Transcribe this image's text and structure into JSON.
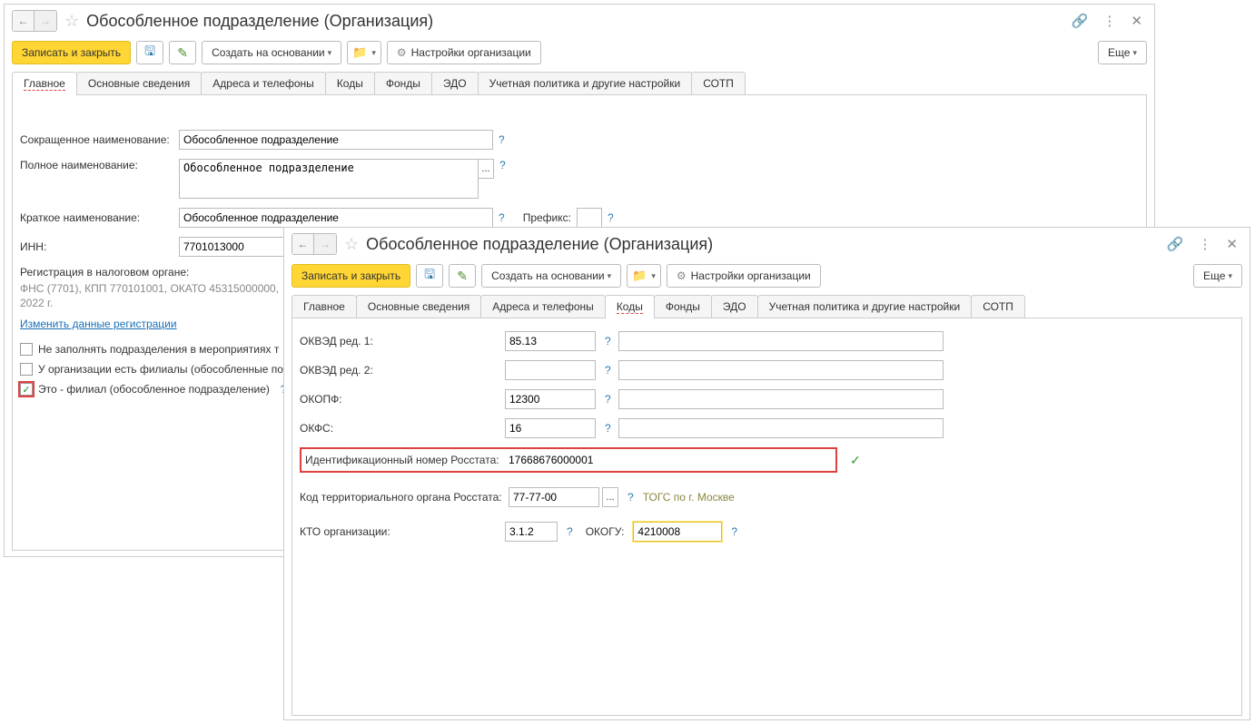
{
  "win1": {
    "title": "Обособленное подразделение (Организация)",
    "toolbar": {
      "save_close": "Записать и закрыть",
      "create_based": "Создать на основании",
      "org_settings": "Настройки организации",
      "more": "Еще"
    },
    "tabs": {
      "t0": "Главное",
      "t1": "Основные сведения",
      "t2": "Адреса и телефоны",
      "t3": "Коды",
      "t4": "Фонды",
      "t5": "ЭДО",
      "t6": "Учетная политика и другие настройки",
      "t7": "СОТП"
    },
    "form": {
      "short_label": "Сокращенное наименование:",
      "short_value": "Обособленное подразделение",
      "full_label": "Полное наименование:",
      "full_value": "Обособленное подразделение",
      "brief_label": "Краткое наименование:",
      "brief_value": "Обособленное подразделение",
      "prefix_label": "Префикс:",
      "prefix_value": "",
      "inn_label": "ИНН:",
      "inn_value": "7701013000",
      "reg_header": "Регистрация в налоговом органе:",
      "reg_text": "ФНС (7701), КПП 770101001, ОКАТО 45315000000, 2022 г.",
      "change_reg_link": "Изменить данные регистрации",
      "chk1": "Не заполнять подразделения в мероприятиях т",
      "chk2": "У организации есть филиалы (обособленные по",
      "chk3": "Это - филиал (обособленное подразделение)"
    }
  },
  "win2": {
    "title": "Обособленное подразделение (Организация)",
    "toolbar": {
      "save_close": "Записать и закрыть",
      "create_based": "Создать на основании",
      "org_settings": "Настройки организации",
      "more": "Еще"
    },
    "tabs": {
      "t0": "Главное",
      "t1": "Основные сведения",
      "t2": "Адреса и телефоны",
      "t3": "Коды",
      "t4": "Фонды",
      "t5": "ЭДО",
      "t6": "Учетная политика и другие настройки",
      "t7": "СОТП"
    },
    "codes": {
      "okved1_label": "ОКВЭД ред. 1:",
      "okved1_value": "85.13",
      "okved2_label": "ОКВЭД ред. 2:",
      "okved2_value": "",
      "okopf_label": "ОКОПФ:",
      "okopf_value": "12300",
      "okfs_label": "ОКФС:",
      "okfs_value": "16",
      "rosstat_id_label": "Идентификационный номер Росстата:",
      "rosstat_id_value": "17668676000001",
      "terr_label": "Код территориального органа Росстата:",
      "terr_value": "77-77-00",
      "terr_hint": "ТОГС по г. Москве",
      "kto_label": "КТО организации:",
      "kto_value": "3.1.2",
      "okogu_label": "ОКОГУ:",
      "okogu_value": "4210008"
    }
  }
}
